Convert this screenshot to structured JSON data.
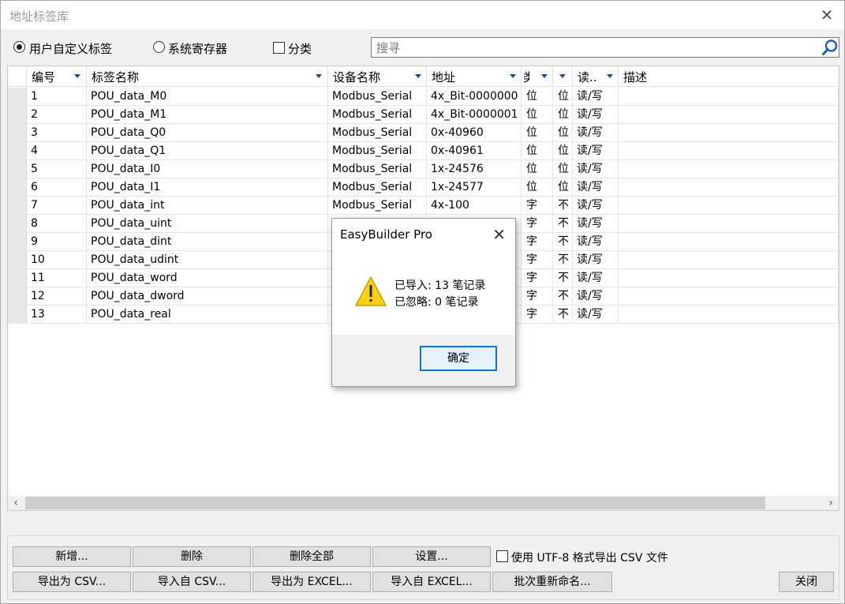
{
  "window": {
    "title": "地址标签库"
  },
  "filters": {
    "radio_user": "用户自定义标签",
    "radio_system": "系统寄存器",
    "checkbox_category": "分类",
    "search_placeholder": "搜寻"
  },
  "columns": [
    "编号",
    "标签名称",
    "设备名称",
    "地址",
    "类",
    "",
    "读..",
    "描述"
  ],
  "rows": [
    [
      "1",
      "POU_data_M0",
      "Modbus_Serial",
      "4x_Bit-0000000",
      "位",
      "位",
      "读/写",
      ""
    ],
    [
      "2",
      "POU_data_M1",
      "Modbus_Serial",
      "4x_Bit-0000001",
      "位",
      "位",
      "读/写",
      ""
    ],
    [
      "3",
      "POU_data_Q0",
      "Modbus_Serial",
      "0x-40960",
      "位",
      "位",
      "读/写",
      ""
    ],
    [
      "4",
      "POU_data_Q1",
      "Modbus_Serial",
      "0x-40961",
      "位",
      "位",
      "读/写",
      ""
    ],
    [
      "5",
      "POU_data_I0",
      "Modbus_Serial",
      "1x-24576",
      "位",
      "位",
      "读/写",
      ""
    ],
    [
      "6",
      "POU_data_I1",
      "Modbus_Serial",
      "1x-24577",
      "位",
      "位",
      "读/写",
      ""
    ],
    [
      "7",
      "POU_data_int",
      "Modbus_Serial",
      "4x-100",
      "字",
      "不",
      "读/写",
      ""
    ],
    [
      "8",
      "POU_data_uint",
      "",
      "",
      "字",
      "不",
      "读/写",
      ""
    ],
    [
      "9",
      "POU_data_dint",
      "",
      "",
      "字",
      "不",
      "读/写",
      ""
    ],
    [
      "10",
      "POU_data_udint",
      "",
      "",
      "字",
      "不",
      "读/写",
      ""
    ],
    [
      "11",
      "POU_data_word",
      "",
      "",
      "字",
      "不",
      "读/写",
      ""
    ],
    [
      "12",
      "POU_data_dword",
      "",
      "",
      "字",
      "不",
      "读/写",
      ""
    ],
    [
      "13",
      "POU_data_real",
      "",
      "",
      "字",
      "不",
      "读/写",
      ""
    ]
  ],
  "buttons": {
    "add": "新增...",
    "delete": "删除",
    "delete_all": "删除全部",
    "settings": "设置...",
    "utf8_checkbox": "使用 UTF-8 格式导出 CSV 文件",
    "export_csv": "导出为 CSV...",
    "import_csv": "导入自 CSV...",
    "export_excel": "导出为 EXCEL...",
    "import_excel": "导入自 EXCEL...",
    "batch_rename": "批次重新命名...",
    "close": "关闭"
  },
  "dialog": {
    "title": "EasyBuilder Pro",
    "line1": "已导入: 13 笔记录",
    "line2": "已忽略: 0 笔记录",
    "ok": "确定"
  },
  "icons": {
    "close": "close-icon",
    "search": "search-icon",
    "warning": "warning-icon",
    "sort": "chevron-down-icon",
    "scroll_left": "chevron-left-icon",
    "scroll_right": "chevron-right-icon"
  },
  "colors": {
    "accent": "#0078d7",
    "warning": "#f7d117"
  }
}
